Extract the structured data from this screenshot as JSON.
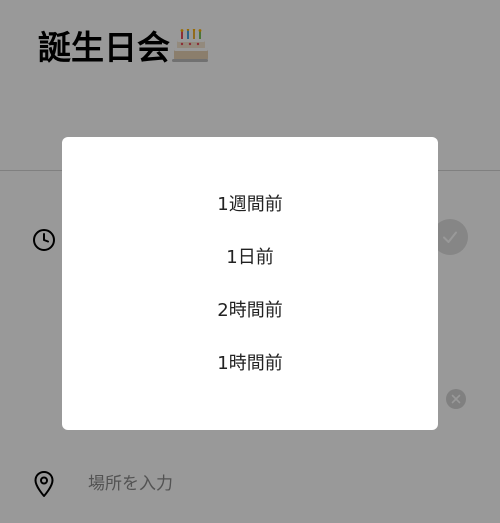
{
  "event": {
    "title": "誕生日会",
    "title_emoji": "cake-icon"
  },
  "reminder": {
    "icon": "clock-icon",
    "toggle_icon": "check-icon",
    "clear_icon": "close-icon"
  },
  "location": {
    "icon": "map-pin-icon",
    "placeholder": "場所を入力",
    "value": ""
  },
  "reminder_dialog": {
    "options": [
      {
        "label": "1週間前"
      },
      {
        "label": "1日前"
      },
      {
        "label": "2時間前"
      },
      {
        "label": "1時間前"
      }
    ]
  },
  "colors": {
    "scrim": "#000000",
    "dialog_background": "#ffffff",
    "text": "#222222",
    "placeholder": "#8a8a8a"
  }
}
